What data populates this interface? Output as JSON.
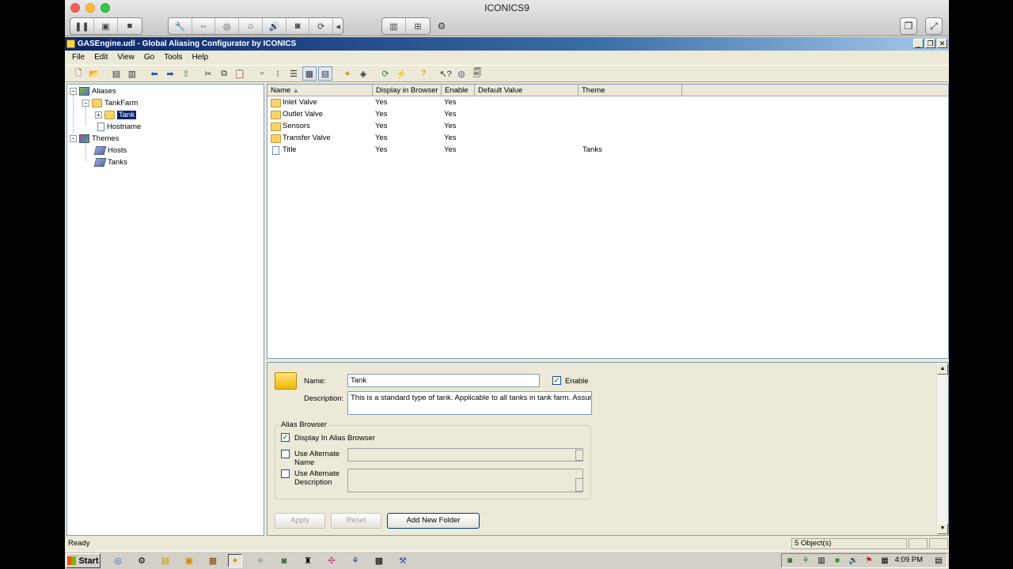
{
  "mac": {
    "title": "ICONICS9"
  },
  "app": {
    "title": "GASEngine.udl - Global Aliasing Configurator by ICONICS",
    "menu": [
      "File",
      "Edit",
      "View",
      "Go",
      "Tools",
      "Help"
    ]
  },
  "tree": {
    "aliases": "Aliases",
    "tankfarm": "TankFarm",
    "tank": "Tank",
    "hostname": "Hostname",
    "themes": "Themes",
    "hosts": "Hosts",
    "tanks": "Tanks"
  },
  "list": {
    "headers": [
      "Name",
      "Display in Browser",
      "Enable",
      "Default Value",
      "Theme"
    ],
    "rows": [
      {
        "name": "Inlet Valve",
        "display": "Yes",
        "enable": "Yes",
        "default": "",
        "theme": "",
        "icon": "folder-icon"
      },
      {
        "name": "Outlet Valve",
        "display": "Yes",
        "enable": "Yes",
        "default": "",
        "theme": "",
        "icon": "folder-icon"
      },
      {
        "name": "Sensors",
        "display": "Yes",
        "enable": "Yes",
        "default": "",
        "theme": "",
        "icon": "folder-icon"
      },
      {
        "name": "Transfer Valve",
        "display": "Yes",
        "enable": "Yes",
        "default": "",
        "theme": "",
        "icon": "folder-icon"
      },
      {
        "name": "Title",
        "display": "Yes",
        "enable": "Yes",
        "default": "",
        "theme": "Tanks",
        "icon": "page-icon"
      }
    ]
  },
  "detail": {
    "name_label": "Name:",
    "name_value": "Tank",
    "enable_label": "Enable",
    "description_label": "Description:",
    "description_value": "This is a standard type of tank. Applicable to all tanks in tank farm. Assumi",
    "alias_browser_label": "Alias Browser",
    "display_in_browser_label": "Display In Alias Browser",
    "use_alt_name_label": "Use Alternate Name",
    "use_alt_desc_label": "Use Alternate Description",
    "apply_label": "Apply",
    "reset_label": "Reset",
    "add_folder_label": "Add New Folder"
  },
  "status": {
    "left": "Ready",
    "count": "5 Object(s)"
  },
  "taskbar": {
    "start": "Start",
    "clock": "4:09 PM"
  }
}
